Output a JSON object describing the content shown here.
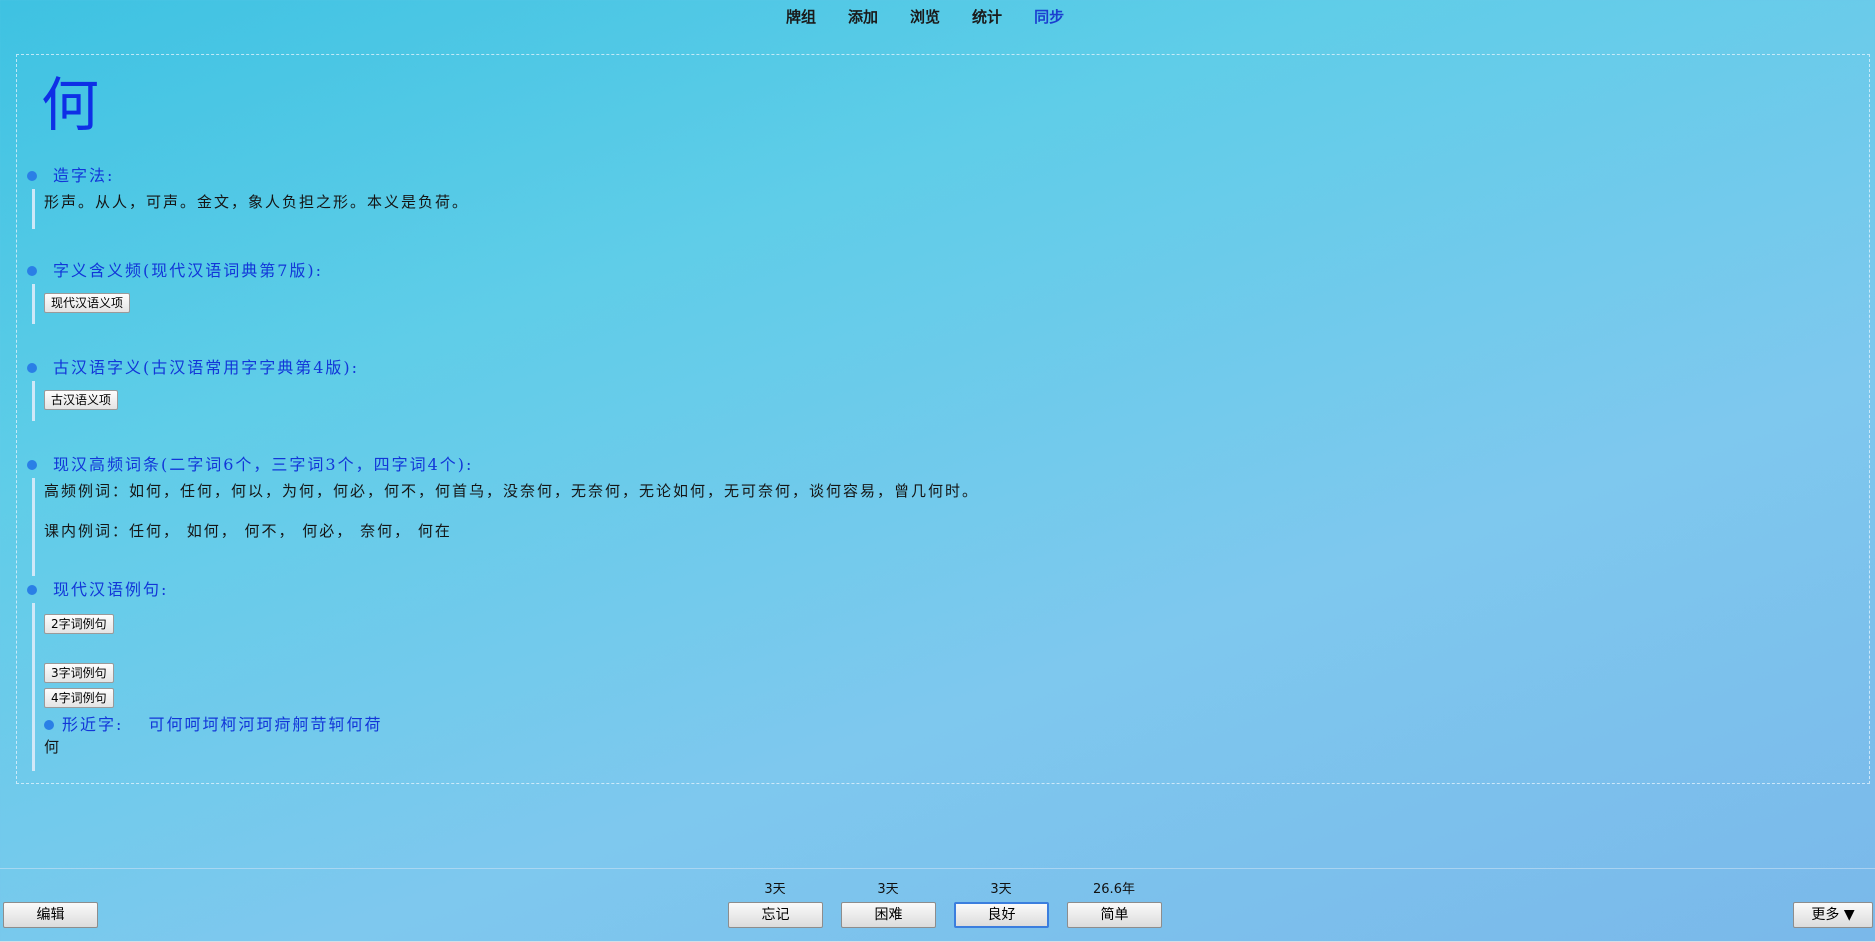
{
  "nav": {
    "items": [
      {
        "label": "牌组"
      },
      {
        "label": "添加"
      },
      {
        "label": "浏览"
      },
      {
        "label": "统计"
      },
      {
        "label": "同步"
      }
    ]
  },
  "card": {
    "character": "何",
    "sections": {
      "formation": {
        "title": "造字法:",
        "text": "形声。从人，可声。金文，象人负担之形。本义是负荷。"
      },
      "modern_meanings": {
        "title": "字义含义频(现代汉语词典第7版):",
        "button": "现代汉语义项"
      },
      "ancient_meanings": {
        "title": "古汉语字义(古汉语常用字字典第4版):",
        "button": "古汉语义项"
      },
      "frequent_words": {
        "title": "现汉高频词条(二字词6个，三字词3个，四字词4个):",
        "high_freq": "高频例词：如何，任何，何以，为何，何必，何不，何首乌，没奈何，无奈何，无论如何，无可奈何，谈何容易，曾几何时。",
        "in_class": "课内例词：任何， 如何， 何不， 何必， 奈何， 何在"
      },
      "example_sentences": {
        "title": "现代汉语例句:",
        "btn_2": "2字词例句",
        "btn_3": "3字词例句",
        "btn_4": "4字词例句",
        "similar_title": "形近字:",
        "similar_chars": "可何呵坷柯河珂疴舸苛轲何荷",
        "similar_body": "何"
      }
    }
  },
  "footer": {
    "edit_label": "编辑",
    "more_label": "更多 ▼",
    "answers": [
      {
        "interval": "3天",
        "label": "忘记"
      },
      {
        "interval": "3天",
        "label": "困难"
      },
      {
        "interval": "3天",
        "label": "良好"
      },
      {
        "interval": "26.6年",
        "label": "简单"
      }
    ]
  }
}
